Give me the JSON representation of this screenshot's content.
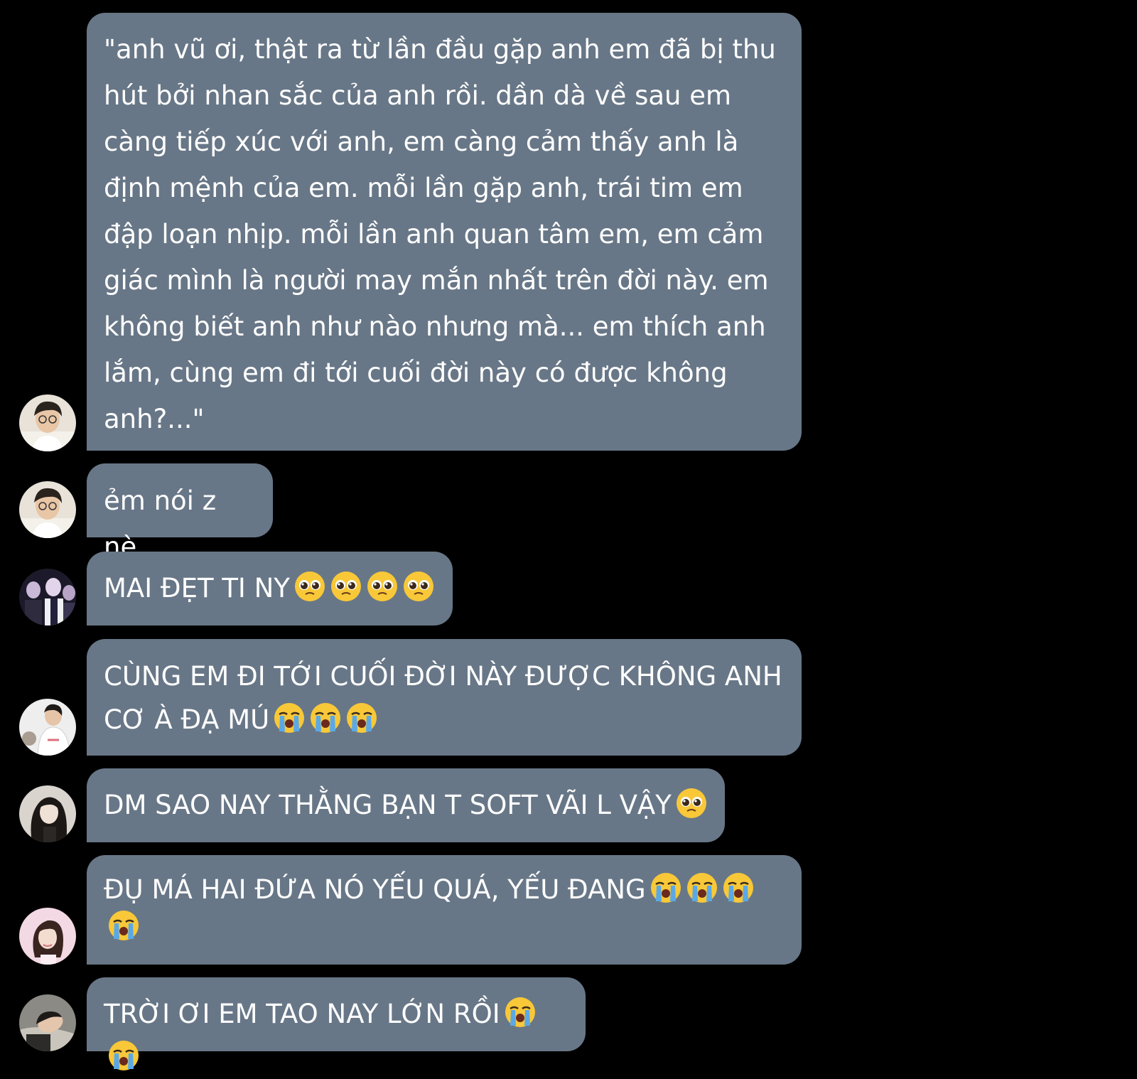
{
  "colors": {
    "background": "#000000",
    "bubble": "#687787",
    "text": "#ffffff"
  },
  "messages": [
    {
      "avatar": "avatar-boy-glasses-icon",
      "text": "\"anh vũ ơi, thật ra từ lần đầu gặp anh em đã bị thu hút bởi nhan sắc của anh rồi. dần dà về sau em càng tiếp xúc với anh, em càng cảm thấy anh là định mệnh của em. mỗi lần gặp anh, trái tim em đập loạn nhịp. mỗi lần anh quan tâm em, em cảm giác mình là người may mắn nhất trên đời này. em không biết anh như nào nhưng mà... em thích anh lắm, cùng em đi tới cuối đời này có được không anh?...\"",
      "emojis": []
    },
    {
      "avatar": "avatar-boy-glasses-icon",
      "text": "ẻm nói z nè",
      "emojis": []
    },
    {
      "avatar": "avatar-group-stage-icon",
      "text": "MAI ĐẸT TI NY",
      "emojis": [
        "pleading-face-emoji",
        "pleading-face-emoji",
        "pleading-face-emoji",
        "pleading-face-emoji"
      ]
    },
    {
      "avatar": "avatar-boy-white-shirt-icon",
      "text": "CÙNG EM ĐI TỚI CUỐI ĐỜI NÀY ĐƯỢC KHÔNG ANH CƠ À ĐẠ MÚ",
      "emojis": [
        "loudly-crying-face-emoji",
        "loudly-crying-face-emoji",
        "loudly-crying-face-emoji"
      ]
    },
    {
      "avatar": "avatar-dark-hair-girl-icon",
      "text": "DM SAO NAY THẰNG BẠN T SOFT VÃI L VẬY",
      "emojis": [
        "pleading-face-emoji"
      ]
    },
    {
      "avatar": "avatar-pink-portrait-icon",
      "text": "ĐỤ MÁ HAI ĐỨA NÓ YẾU QUÁ, YẾU ĐANG",
      "emojis": [
        "loudly-crying-face-emoji",
        "loudly-crying-face-emoji",
        "loudly-crying-face-emoji",
        "loudly-crying-face-emoji"
      ]
    },
    {
      "avatar": "avatar-sleeping-boy-icon",
      "text": "TRỜI ƠI EM TAO NAY LỚN RỒI",
      "emojis": [
        "loudly-crying-face-emoji",
        "loudly-crying-face-emoji"
      ]
    }
  ]
}
